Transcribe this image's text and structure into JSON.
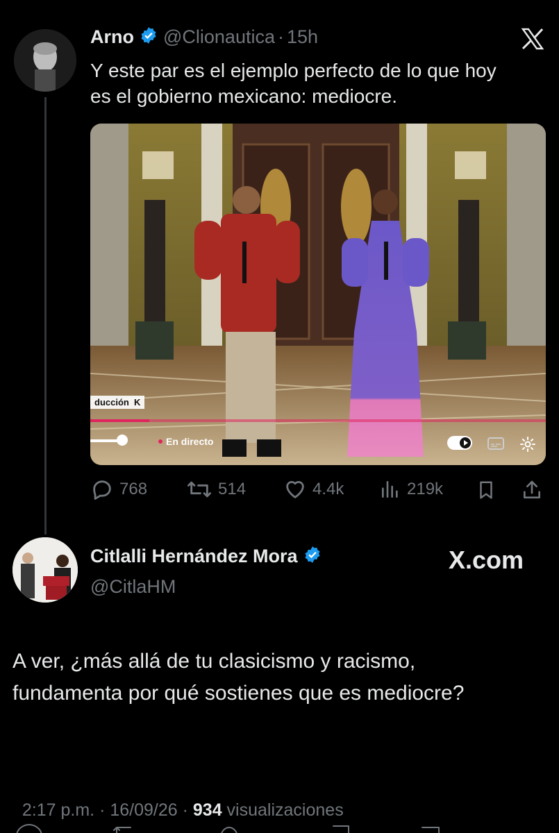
{
  "quoted_tweet": {
    "author_name": "Arno",
    "handle": "@Clionautica",
    "separator": "·",
    "time": "15h",
    "text": "Y este par es el ejemplo perfecto de lo que hoy es el gobierno mexicano: mediocre.",
    "video": {
      "overlay_label": "ducción  K",
      "live_label": "En directo",
      "progress": 0.13
    },
    "metrics": {
      "replies": "768",
      "reposts": "514",
      "likes": "4.4k",
      "views": "219k"
    }
  },
  "reply_tweet": {
    "author_name": "Citlalli Hernández Mora",
    "handle": "@CitlaHM",
    "brand": "X.com",
    "text": "A ver, ¿más allá de tu clasicismo y racismo, fundamenta por qué sostienes que es mediocre?",
    "timestamp": "2:17 p.m. · 16/09/26 · ",
    "views_count": "934",
    "views_label": " visualizaciones"
  },
  "colors": {
    "background": "#000000",
    "text": "#e7e9ea",
    "muted": "#71767b",
    "verified": "#1d9bf0",
    "video_progress": "#e0245e"
  }
}
